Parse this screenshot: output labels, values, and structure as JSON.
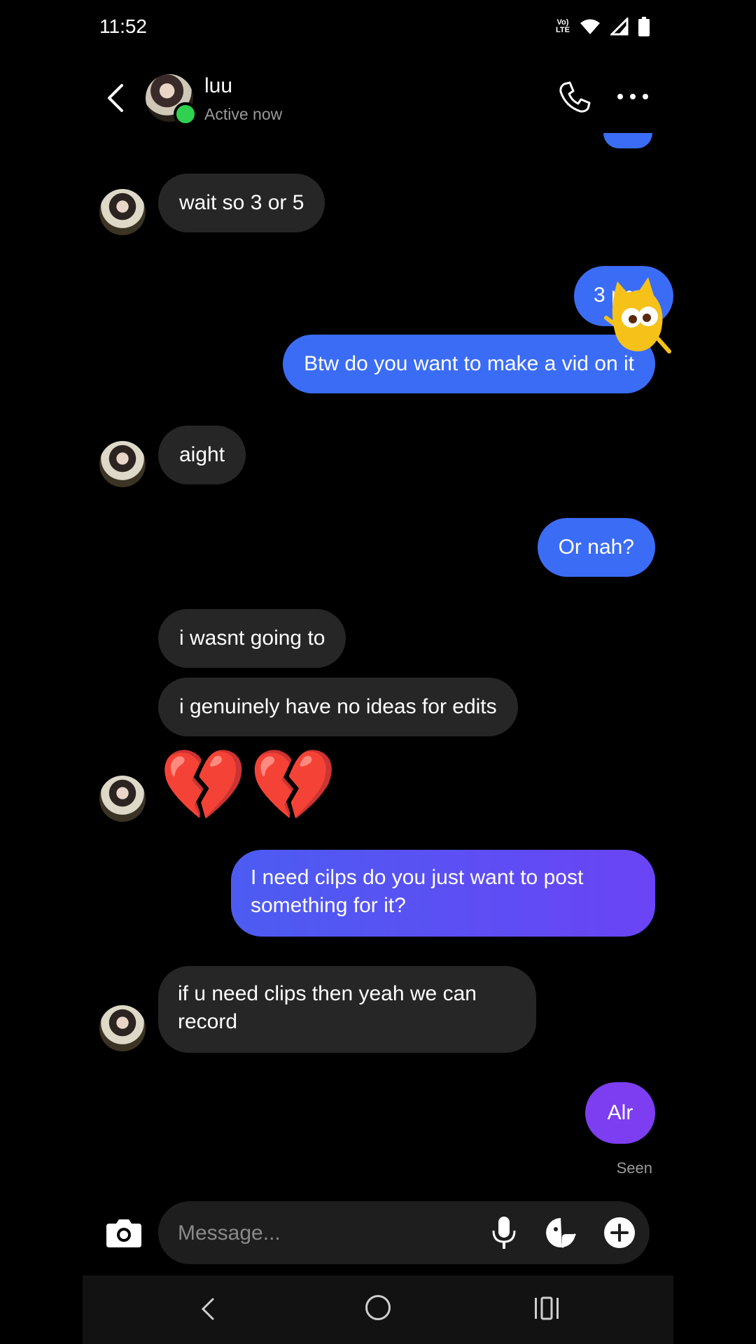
{
  "status_bar": {
    "time": "11:52",
    "network_label": "VoLTE"
  },
  "header": {
    "name": "luu",
    "status": "Active now"
  },
  "messages": [
    {
      "from": "them",
      "text": "wait so 3 or 5"
    },
    {
      "from": "me",
      "text": "3 pm"
    },
    {
      "from": "me",
      "text": "Btw do you want to make a vid on it"
    },
    {
      "from": "them",
      "text": "aight"
    },
    {
      "from": "me",
      "text": "Or nah?"
    },
    {
      "from": "them",
      "text": "i wasnt going to"
    },
    {
      "from": "them",
      "text": "i genuinely have no ideas for edits"
    },
    {
      "from": "them",
      "text": "💔💔"
    },
    {
      "from": "me",
      "text": "I need cilps do you just want to post something for it?"
    },
    {
      "from": "them",
      "text": "if u need clips then yeah we can record"
    },
    {
      "from": "me",
      "text": "Alr"
    }
  ],
  "seen_label": "Seen",
  "composer": {
    "placeholder": "Message..."
  },
  "colors": {
    "sent": "#3b6cf5",
    "received": "#262626",
    "online": "#2fd14f"
  }
}
